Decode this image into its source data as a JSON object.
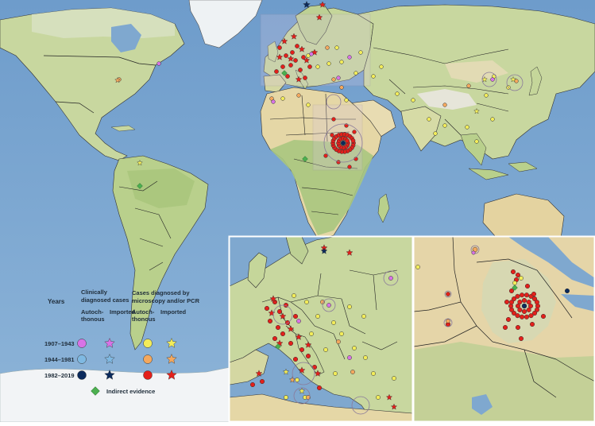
{
  "legend": {
    "years_heading": "Years",
    "clinical_heading_line1": "Clinically",
    "clinical_heading_line2": "diagnosed cases",
    "micro_heading_line1": "Cases diagnosed by",
    "micro_heading_line2": "microscopy and/or PCR",
    "autoch_line1": "Autoch-",
    "autoch_line2": "thonous",
    "imported": "Imported",
    "rows": [
      {
        "years": "1907–1943",
        "color": "#d873e6",
        "micro_color": "#f2ec5a"
      },
      {
        "years": "1944–1981",
        "color": "#7fb9e2",
        "micro_color": "#f4a85e"
      },
      {
        "years": "1982–2019",
        "color": "#0b2a5c",
        "micro_color": "#e3201b"
      }
    ],
    "indirect": "Indirect evidence",
    "indirect_color": "#4caf50"
  },
  "colors": {
    "ocean": "#7fa8cf",
    "land": "#c9d8a0",
    "desert": "#e6d9b0",
    "ice": "#f4f6f8",
    "border": "#222222",
    "inset_frame": "#ffffff"
  }
}
